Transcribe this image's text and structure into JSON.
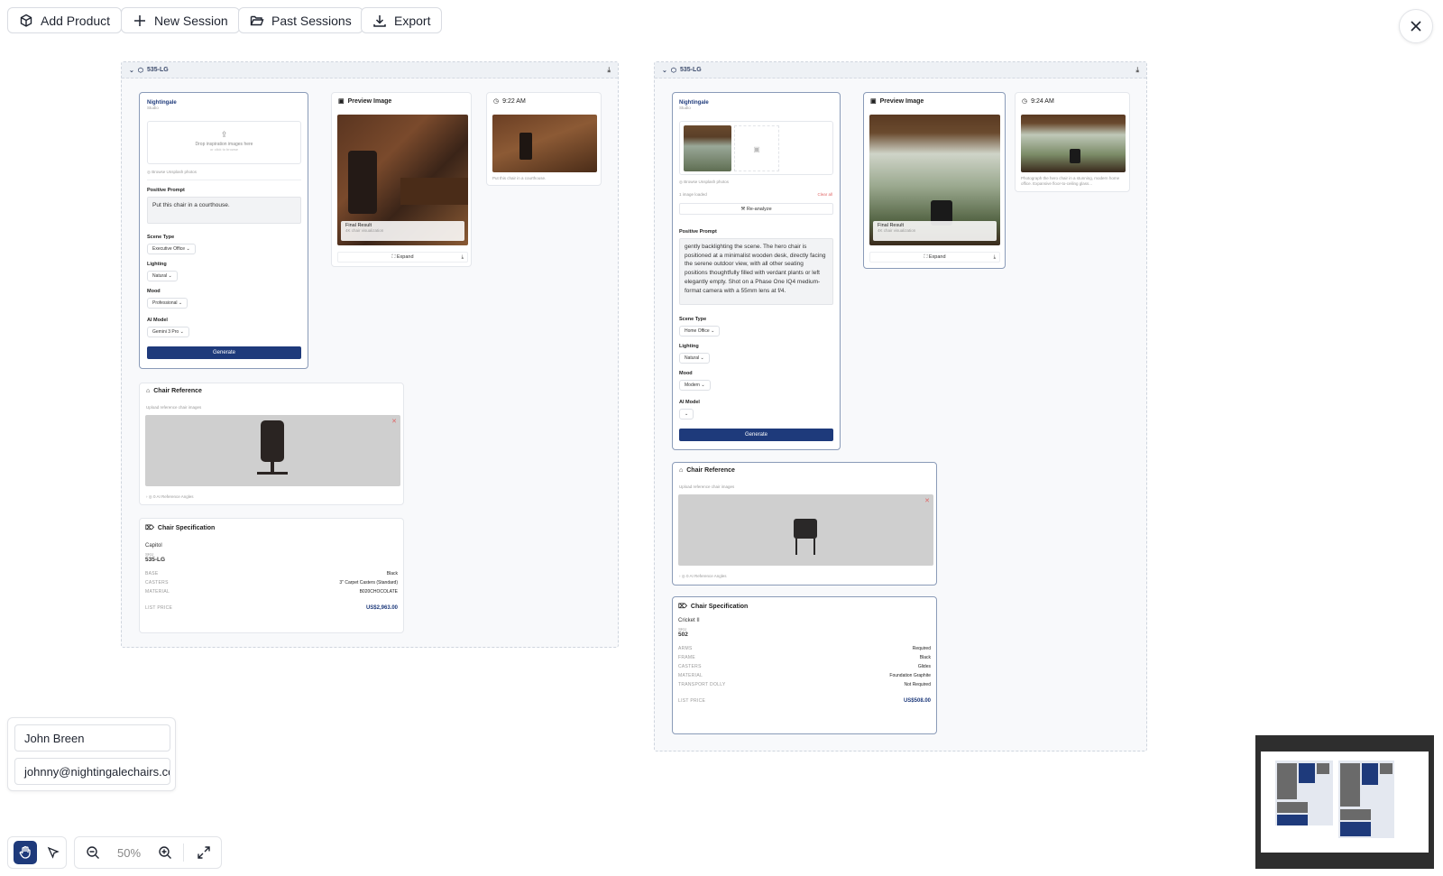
{
  "toolbar": {
    "add_product": "Add Product",
    "new_session": "New Session",
    "past_sessions": "Past Sessions",
    "export": "Export"
  },
  "frames": [
    {
      "header": "535-LG",
      "inspiration": {
        "brand": "Nightingale",
        "brand_sub": "Studio",
        "drop_text": "Drop inspiration images here",
        "drop_sub": "or click to browse",
        "browse": "Browse Unsplash photos",
        "positive_prompt_label": "Positive Prompt",
        "positive_prompt": "Put this chair in a courthouse.",
        "scene_label": "Scene Type",
        "scene": "Executive Office",
        "lighting_label": "Lighting",
        "lighting": "Natural",
        "mood_label": "Mood",
        "mood": "Professional",
        "model_label": "AI Model",
        "model": "Gemini 3 Pro",
        "generate": "Generate"
      },
      "preview": {
        "title": "Preview Image",
        "final_result": "Final Result",
        "final_sub": "4K chair visualization",
        "expand": "Expand"
      },
      "history": {
        "time": "9:22 AM",
        "caption": "Put this chair in a courthouse."
      },
      "chair_reference": {
        "title": "Chair Reference",
        "sub": "Upload reference chair images",
        "angles": "0 AI Reference Angles"
      },
      "spec": {
        "title": "Chair Specification",
        "name": "Capitol",
        "sku_label": "SKU",
        "sku": "535-LG",
        "rows": [
          {
            "k": "BASE",
            "v": "Black"
          },
          {
            "k": "CASTERS",
            "v": "3\" Carpet Casters (Standard)"
          },
          {
            "k": "MATERIAL",
            "v": "B020CHOCOLATE"
          }
        ],
        "price_label": "LIST PRICE",
        "price": "US$2,963.00"
      }
    },
    {
      "header": "535-LG",
      "inspiration": {
        "brand": "Nightingale",
        "brand_sub": "Studio",
        "browse": "Browse Unsplash photos",
        "loaded": "1 image loaded",
        "clear": "Clear all",
        "reanalyze": "Re-analyze",
        "positive_prompt_label": "Positive Prompt",
        "positive_prompt": "gently backlighting the scene. The hero chair is positioned at a minimalist wooden desk, directly facing the serene outdoor view, with all other seating positions thoughtfully filled with verdant plants or left elegantly empty. Shot on a Phase One IQ4 medium-format camera with a 55mm lens at f/4.",
        "scene_label": "Scene Type",
        "scene": "Home Office",
        "lighting_label": "Lighting",
        "lighting": "Natural",
        "mood_label": "Mood",
        "mood": "Modern",
        "model_label": "AI Model",
        "model": "",
        "generate": "Generate"
      },
      "preview": {
        "title": "Preview Image",
        "final_result": "Final Result",
        "final_sub": "4K chair visualization",
        "expand": "Expand"
      },
      "history": {
        "time": "9:24 AM",
        "caption": "Photograph the hero chair in a stunning, modern home office. Expansive floor-to-ceiling glass..."
      },
      "chair_reference": {
        "title": "Chair Reference",
        "sub": "Upload reference chair images",
        "angles": "0 AI Reference Angles"
      },
      "spec": {
        "title": "Chair Specification",
        "name": "Cricket II",
        "sku_label": "SKU",
        "sku": "502",
        "rows": [
          {
            "k": "ARMS",
            "v": "Required"
          },
          {
            "k": "FRAME",
            "v": "Black"
          },
          {
            "k": "CASTERS",
            "v": "Glides"
          },
          {
            "k": "MATERIAL",
            "v": "Foundation Graphite"
          },
          {
            "k": "TRANSPORT DOLLY",
            "v": "Not Required"
          }
        ],
        "price_label": "LIST PRICE",
        "price": "US$508.00"
      }
    }
  ],
  "user": {
    "name": "John Breen",
    "email": "johnny@nightingalechairs.com"
  },
  "zoom": {
    "level": "50%"
  },
  "colors": {
    "accent": "#1e3a7b",
    "minimap_bg": "#2e2e2e"
  }
}
